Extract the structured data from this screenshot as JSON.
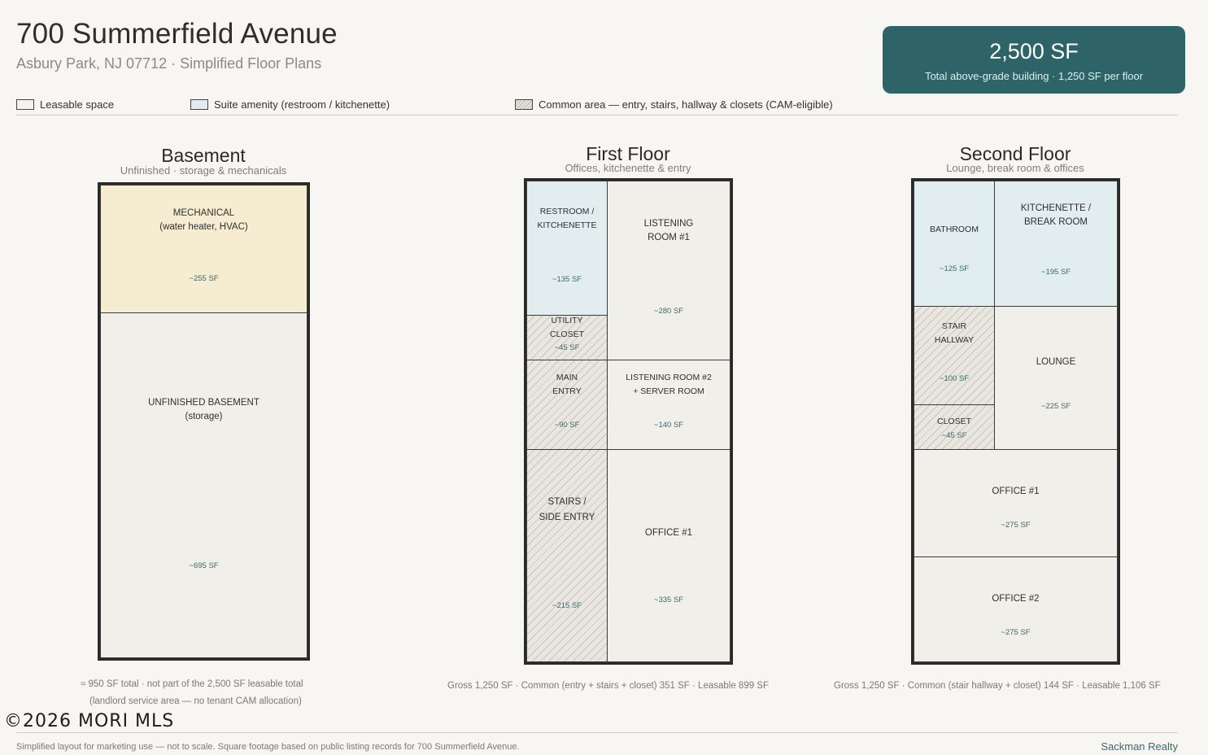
{
  "header": {
    "title": "700 Summerfield Avenue",
    "subtitle": "Asbury Park, NJ 07712  ·  Simplified Floor Plans"
  },
  "badge": {
    "total": "2,500 SF",
    "detail": "Total above-grade building  ·  1,250 SF per floor"
  },
  "legend": {
    "leasable": "Leasable space",
    "amenity": "Suite amenity (restroom / kitchenette)",
    "common": "Common area — entry, stairs, hallway & closets (CAM-eligible)"
  },
  "basement": {
    "title": "Basement",
    "subtitle": "Unfinished · storage & mechanicals",
    "rooms": {
      "mech": {
        "label": "MECHANICAL\n(water heater, HVAC)",
        "sf": "~255 SF"
      },
      "unfinished": {
        "label": "UNFINISHED BASEMENT\n(storage)",
        "sf": "~695 SF"
      }
    },
    "note1": "≈ 950 SF total  ·  not part of the 2,500 SF leasable total",
    "note2": "(landlord service area — no tenant CAM allocation)"
  },
  "first": {
    "title": "First Floor",
    "subtitle": "Offices, kitchenette & entry",
    "rooms": {
      "restroom": {
        "label": "RESTROOM /\nKITCHENETTE",
        "sf": "~135 SF"
      },
      "listening1": {
        "label": "LISTENING\nROOM #1",
        "sf": "~280 SF"
      },
      "utility": {
        "label": "UTILITY\nCLOSET",
        "sf": "~45 SF"
      },
      "entry": {
        "label": "MAIN\nENTRY",
        "sf": "~90 SF"
      },
      "listening2": {
        "label": "LISTENING ROOM #2\n+ SERVER ROOM",
        "sf": "~140 SF"
      },
      "stairs": {
        "label": "STAIRS /\nSIDE ENTRY",
        "sf": "~215 SF"
      },
      "office1": {
        "label": "OFFICE #1",
        "sf": "~335 SF"
      }
    },
    "summary": "Gross 1,250 SF   ·   Common (entry + stairs + closet) 351 SF   ·   Leasable 899 SF"
  },
  "second": {
    "title": "Second Floor",
    "subtitle": "Lounge, break room & offices",
    "rooms": {
      "bathroom": {
        "label": "BATHROOM",
        "sf": "~125 SF"
      },
      "kitchenette": {
        "label": "KITCHENETTE /\nBREAK ROOM",
        "sf": "~195 SF"
      },
      "hallway": {
        "label": "STAIR\nHALLWAY",
        "sf": "~100 SF"
      },
      "lounge": {
        "label": "LOUNGE",
        "sf": "~225 SF"
      },
      "closet": {
        "label": "CLOSET",
        "sf": "~45 SF"
      },
      "office1": {
        "label": "OFFICE #1",
        "sf": "~275 SF"
      },
      "office2": {
        "label": "OFFICE #2",
        "sf": "~275 SF"
      }
    },
    "summary": "Gross 1,250 SF   ·   Common (stair hallway + closet) 144 SF   ·   Leasable 1,106 SF"
  },
  "watermark": "©2026 MORI MLS",
  "footer": {
    "disclaimer": "Simplified layout for marketing use — not to scale. Square footage based on public listing records for 700 Summerfield Avenue.",
    "brand": "Sackman Realty"
  },
  "colors": {
    "badge": "#2e6468",
    "amenity": "#e2edef",
    "mechanical": "#f5ecd1",
    "leasable": "#f0efea"
  }
}
